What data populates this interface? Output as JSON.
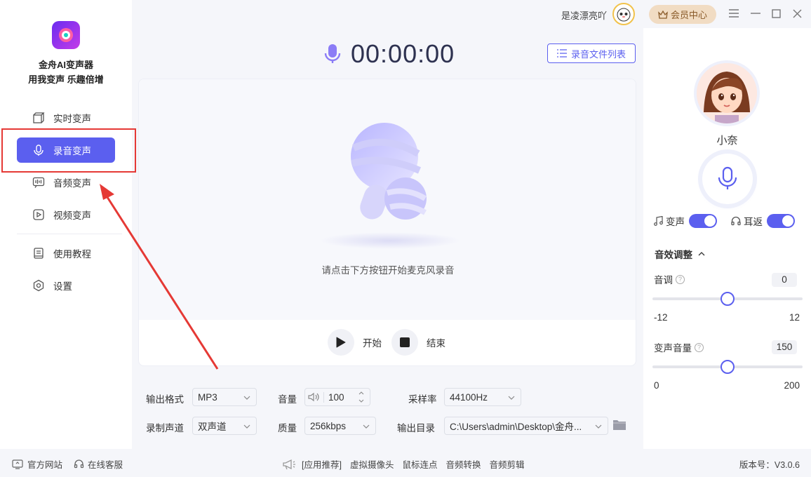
{
  "app": {
    "name": "金舟AI变声器",
    "slogan": "用我变声 乐趣倍增"
  },
  "sidebar": {
    "items": [
      {
        "label": "实时变声",
        "icon": "cube-icon"
      },
      {
        "label": "录音变声",
        "icon": "microphone-icon",
        "active": true
      },
      {
        "label": "音频变声",
        "icon": "audio-wave-icon"
      },
      {
        "label": "视频变声",
        "icon": "video-play-icon"
      },
      {
        "label": "使用教程",
        "icon": "book-icon"
      },
      {
        "label": "设置",
        "icon": "settings-icon"
      }
    ]
  },
  "header": {
    "username": "是凌漂亮吖",
    "vip_label": "会员中心"
  },
  "recording": {
    "timer": "00:00:00",
    "file_list_label": "录音文件列表",
    "hint": "请点击下方按钮开始麦克风录音",
    "start_label": "开始",
    "stop_label": "结束"
  },
  "options": {
    "format_label": "输出格式",
    "format_value": "MP3",
    "volume_label": "音量",
    "volume_value": "100",
    "sample_rate_label": "采样率",
    "sample_rate_value": "44100Hz",
    "channel_label": "录制声道",
    "channel_value": "双声道",
    "quality_label": "质量",
    "quality_value": "256kbps",
    "output_dir_label": "输出目录",
    "output_dir_value": "C:\\Users\\admin\\Desktop\\金舟..."
  },
  "voice_panel": {
    "voice_name": "小奈",
    "voice_change_label": "变声",
    "voice_change_on": true,
    "monitor_label": "耳返",
    "monitor_on": true,
    "effects_title": "音效调整",
    "pitch_label": "音调",
    "pitch_value": "0",
    "pitch_min": "-12",
    "pitch_max": "12",
    "volume_label": "变声音量",
    "volume_value": "150",
    "volume_min": "0",
    "volume_max": "200"
  },
  "footer": {
    "website": "官方网站",
    "support": "在线客服",
    "recommend_label": "[应用推荐]",
    "apps": [
      "虚拟摄像头",
      "鼠标连点",
      "音频转换",
      "音频剪辑"
    ],
    "version": "版本号：V3.0.6"
  },
  "colors": {
    "accent": "#5b5fef",
    "highlight": "#e53935",
    "vip": "#f1dcc3"
  }
}
